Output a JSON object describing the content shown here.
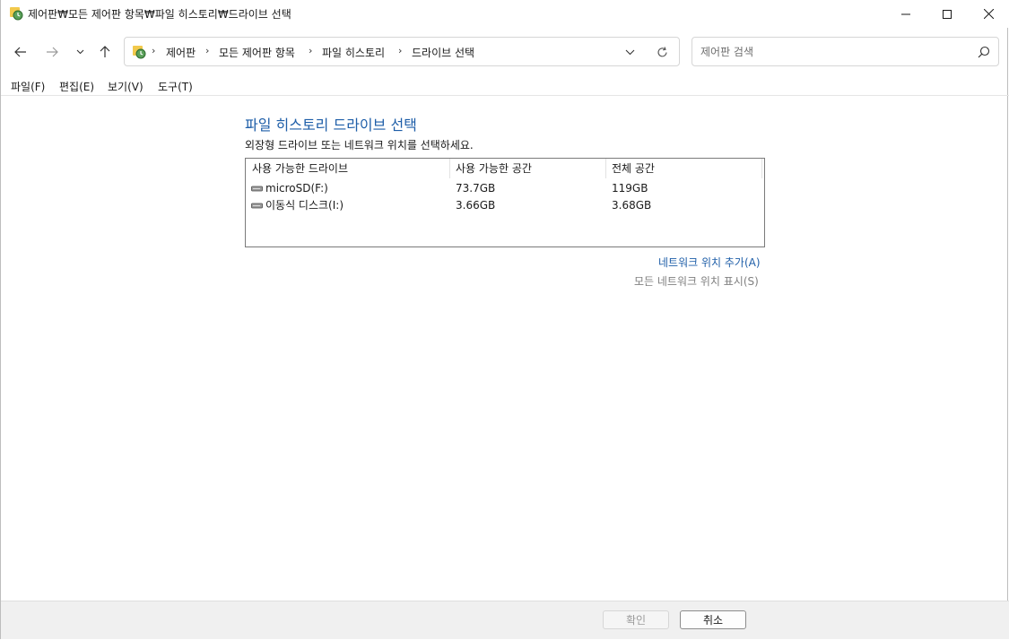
{
  "window": {
    "title": "제어판₩모든 제어판 항목₩파일 히스토리₩드라이브 선택"
  },
  "address": {
    "crumbs": [
      "제어판",
      "모든 제어판 항목",
      "파일 히스토리",
      "드라이브 선택"
    ]
  },
  "search": {
    "placeholder": "제어판 검색"
  },
  "menu": {
    "items": [
      "파일(F)",
      "편집(E)",
      "보기(V)",
      "도구(T)"
    ]
  },
  "main": {
    "heading": "파일 히스토리 드라이브 선택",
    "instruction": "외장형 드라이브 또는 네트워크 위치를 선택하세요.",
    "columns": [
      "사용 가능한 드라이브",
      "사용 가능한 공간",
      "전체 공간"
    ],
    "drives": [
      {
        "name": "microSD(F:)",
        "free": "73.7GB",
        "total": "119GB"
      },
      {
        "name": "이동식 디스크(I:)",
        "free": "3.66GB",
        "total": "3.68GB"
      }
    ],
    "add_network_link": "네트워크 위치 추가(A)",
    "show_all_network_link": "모든 네트워크 위치 표시(S)"
  },
  "footer": {
    "ok_label": "확인",
    "cancel_label": "취소"
  },
  "colors": {
    "heading": "#1e5ea8",
    "link": "#1e5ea8",
    "disabled_text": "#808080"
  },
  "icons": {
    "app": "control-panel-history-icon",
    "drive": "drive-icon"
  }
}
